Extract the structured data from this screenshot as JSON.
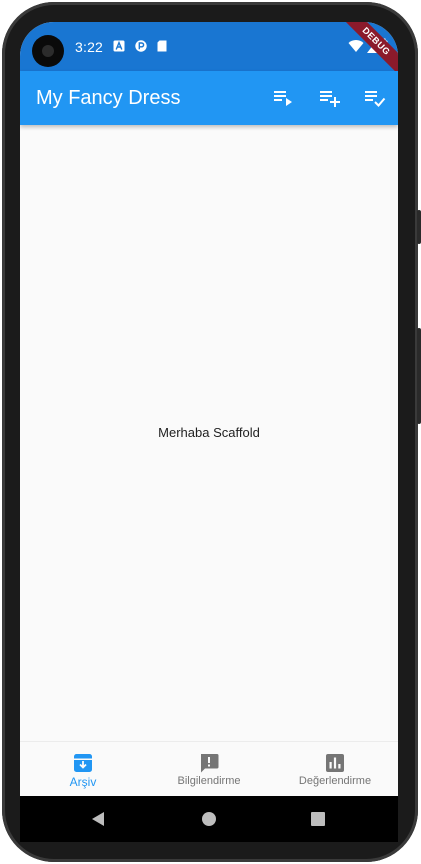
{
  "status_bar": {
    "time": "3:22",
    "debug_label": "DEBUG",
    "color": "#1976d2"
  },
  "app_bar": {
    "title": "My Fancy Dress",
    "color": "#2196f3",
    "actions": [
      "playlist-play-icon",
      "playlist-add-icon",
      "playlist-add-check-icon"
    ]
  },
  "body": {
    "center_text": "Merhaba Scaffold"
  },
  "bottom_nav": {
    "active_color": "#2196f3",
    "inactive_color": "#757575",
    "items": [
      {
        "label": "Arşiv",
        "icon": "archive-icon",
        "active": true
      },
      {
        "label": "Bilgilendirme",
        "icon": "announcement-icon",
        "active": false
      },
      {
        "label": "Değerlendirme",
        "icon": "assessment-icon",
        "active": false
      }
    ]
  },
  "system_nav": [
    "back-icon",
    "home-icon",
    "recents-icon"
  ]
}
